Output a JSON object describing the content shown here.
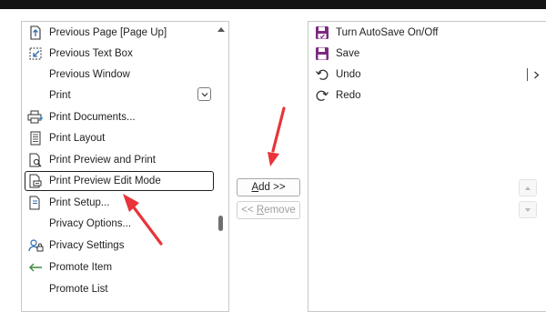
{
  "left_list": {
    "items": [
      {
        "label": "Previous Page [Page Up]",
        "icon": "previous-page-icon"
      },
      {
        "label": "Previous Text Box",
        "icon": "previous-text-box-icon"
      },
      {
        "label": "Previous Window",
        "icon": ""
      },
      {
        "label": "Print",
        "icon": "",
        "has_dropdown": true
      },
      {
        "label": "Print Documents...",
        "icon": "print-documents-icon"
      },
      {
        "label": "Print Layout",
        "icon": "print-layout-icon"
      },
      {
        "label": "Print Preview and Print",
        "icon": "print-preview-icon"
      },
      {
        "label": "Print Preview Edit Mode",
        "icon": "print-preview-edit-icon",
        "selected": true
      },
      {
        "label": "Print Setup...",
        "icon": "print-setup-icon"
      },
      {
        "label": "Privacy Options...",
        "icon": ""
      },
      {
        "label": "Privacy Settings",
        "icon": "privacy-settings-icon"
      },
      {
        "label": "Promote Item",
        "icon": "promote-arrow-icon"
      },
      {
        "label": "Promote List",
        "icon": ""
      }
    ]
  },
  "right_list": {
    "items": [
      {
        "label": "Turn AutoSave On/Off",
        "icon": "autosave-icon"
      },
      {
        "label": "Save",
        "icon": "save-icon"
      },
      {
        "label": "Undo",
        "icon": "undo-icon",
        "has_submenu": true
      },
      {
        "label": "Redo",
        "icon": "redo-icon"
      }
    ]
  },
  "buttons": {
    "add": {
      "mnemonic": "A",
      "rest": "dd >>"
    },
    "remove": {
      "prefix": "<< ",
      "mnemonic": "R",
      "rest": "emove"
    }
  },
  "colors": {
    "annotation_red": "#e8343a",
    "save_purple": "#7b2a7f",
    "promote_green": "#3a8a3a",
    "icon_blue": "#2b6cb0"
  }
}
